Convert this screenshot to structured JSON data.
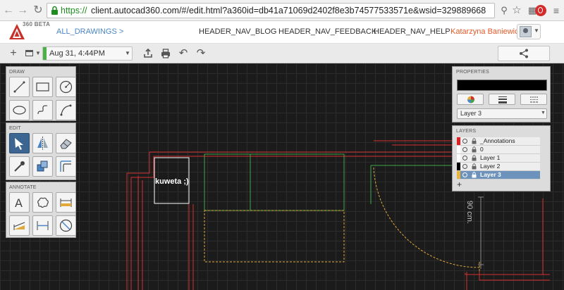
{
  "browser": {
    "url_scheme": "https://",
    "url_rest": "client.autocad360.com/#/edit.html?a360id=db41a71069d2402f8e3b74577533571e&wsid=329889668",
    "back_icon": "arrow-left-icon",
    "forward_icon": "arrow-right-icon",
    "reload_icon": "reload-icon"
  },
  "header": {
    "logo_badge": "360 BETA",
    "all_drawings": "ALL_DRAWINGS >",
    "nav_blog": "HEADER_NAV_BLOG",
    "nav_feedback": "HEADER_NAV_FEEDBACK",
    "nav_help": "HEADER_NAV_HELP",
    "user_name": "Katarzyna Baniewicz"
  },
  "toolbar": {
    "version_label": "Aug 31, 4:44PM",
    "version_color": "#4db14a",
    "plus_label": "+"
  },
  "palettes": {
    "draw_title": "DRAW",
    "draw_tools": [
      "line-icon",
      "rectangle-icon",
      "circle-icon",
      "ellipse-icon",
      "spline-icon",
      "arc-icon"
    ],
    "edit_title": "EDIT",
    "edit_tools": [
      "select-icon",
      "mirror-icon",
      "eraser-icon",
      "eyedropper-icon",
      "copy-icon",
      "offset-icon"
    ],
    "annotate_title": "ANNOTATE",
    "annotate_tools": [
      "text-icon",
      "revision-cloud-icon",
      "linear-dimension-icon",
      "aligned-dimension-icon",
      "measure-icon",
      "radius-icon"
    ]
  },
  "properties": {
    "title": "PROPERTIES",
    "color": "#000000",
    "layer_selected": "Layer 3"
  },
  "layers": {
    "title": "LAYERS",
    "items": [
      {
        "name": "_Annotations",
        "color": "#e02020",
        "selected": false
      },
      {
        "name": "0",
        "color": "#ffffff",
        "selected": false
      },
      {
        "name": "Layer 1",
        "color": "#ffffff",
        "selected": false
      },
      {
        "name": "Layer 2",
        "color": "#000000",
        "selected": false
      },
      {
        "name": "Layer 3",
        "color": "#e8b53a",
        "selected": true
      }
    ],
    "add_label": "+"
  },
  "canvas": {
    "text_label": "kuweta ;)",
    "dimension_label": "90 cm.",
    "colors": {
      "red": "#d42f2f",
      "green": "#3fa64a",
      "yellow": "#e0a93a",
      "white": "#ffffff",
      "gray": "#8a8a8a"
    }
  }
}
